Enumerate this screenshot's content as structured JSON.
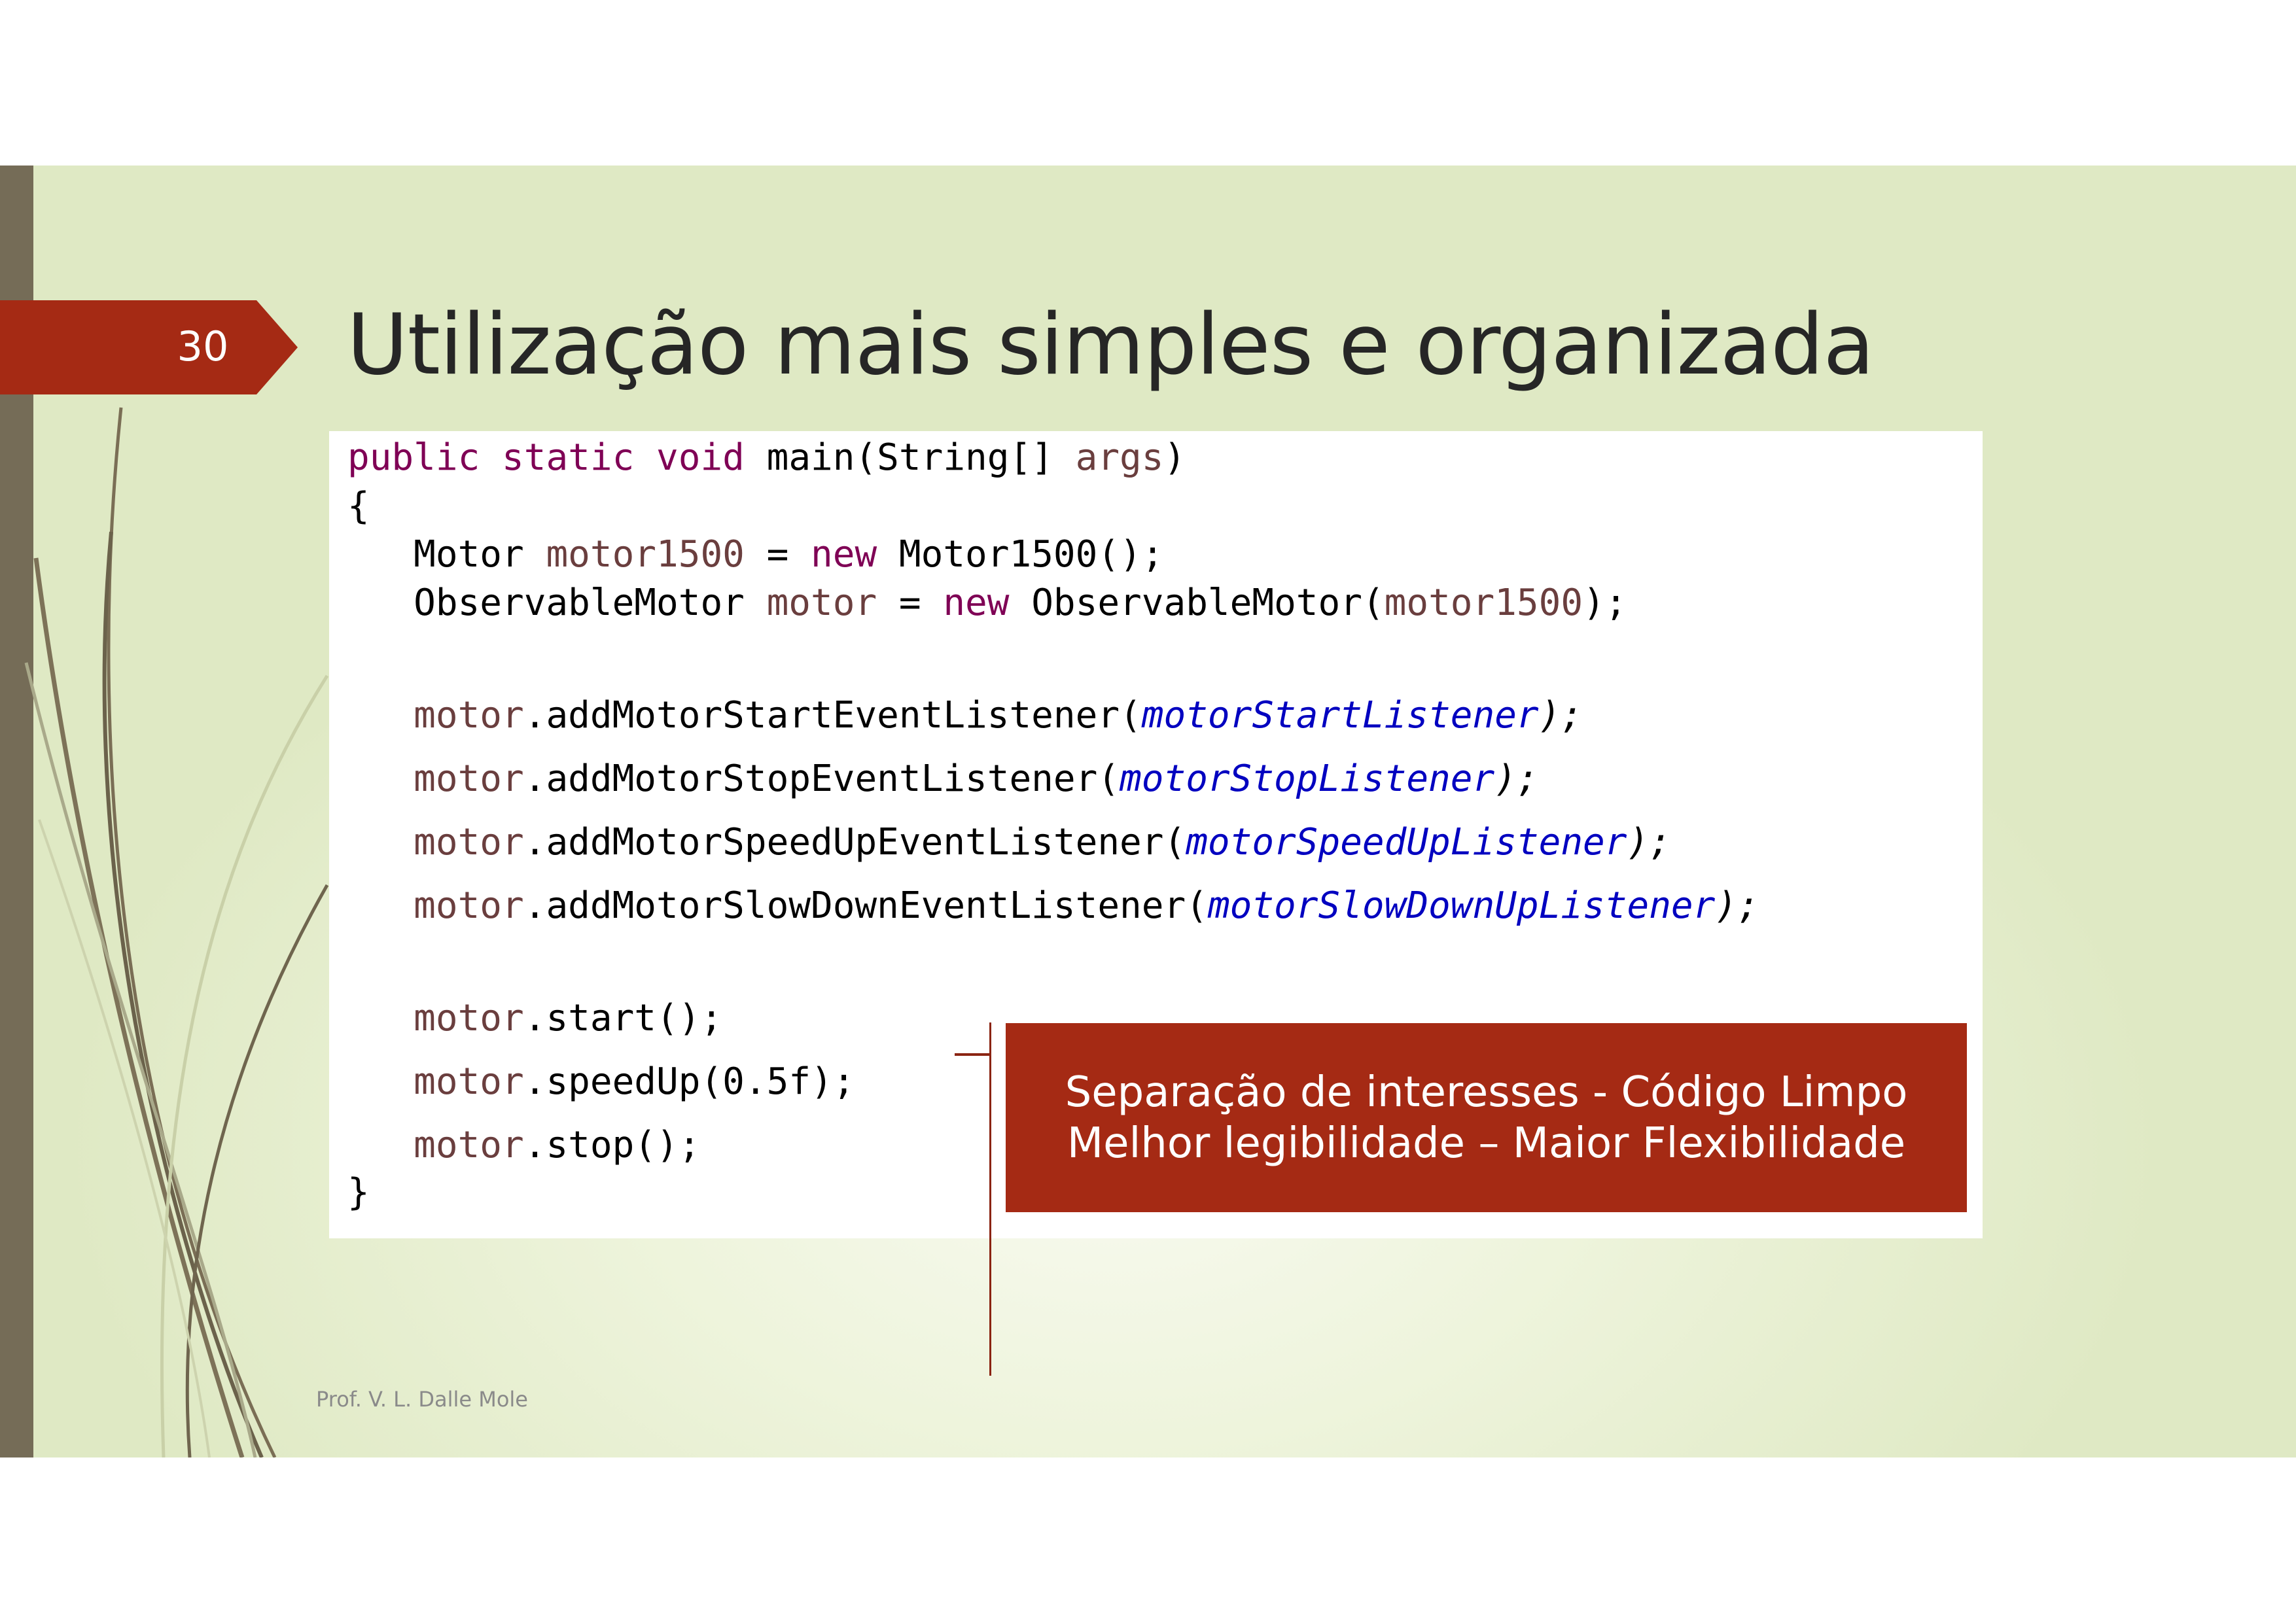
{
  "slide": {
    "number": "30",
    "title": "Utilização mais simples e organizada",
    "footer": "Prof. V. L. Dalle Mole"
  },
  "code": {
    "line1": {
      "kw1": "public",
      "kw2": "static",
      "kw3": "void",
      "rest": " main(String[] ",
      "var": "args",
      "end": ")"
    },
    "line2": "{",
    "line3": {
      "type": "   Motor ",
      "var": "motor1500",
      "eq": " = ",
      "kw": "new",
      "rest": " Motor1500();"
    },
    "line4": {
      "type": "   ObservableMotor ",
      "var": "motor",
      "eq": " = ",
      "kw": "new",
      "rest": " ObservableMotor(",
      "arg": "motor1500",
      "end": ");"
    },
    "listeners": [
      {
        "obj": "motor",
        "call": ".addMotorStartEventListener(",
        "arg": "motorStartListener",
        "end": ");"
      },
      {
        "obj": "motor",
        "call": ".addMotorStopEventListener(",
        "arg": "motorStopListener",
        "end": ");"
      },
      {
        "obj": "motor",
        "call": ".addMotorSpeedUpEventListener(",
        "arg": "motorSpeedUpListener",
        "end": ");"
      },
      {
        "obj": "motor",
        "call": ".addMotorSlowDownEventListener(",
        "arg": "motorSlowDownUpListener",
        "end": ");"
      }
    ],
    "calls": [
      {
        "obj": "motor",
        "call": ".start();"
      },
      {
        "obj": "motor",
        "call": ".speedUp(0.5f);"
      },
      {
        "obj": "motor",
        "call": ".stop();"
      }
    ],
    "closing": "}"
  },
  "callout": {
    "line1": "Separação de interesses - Código Limpo",
    "line2": "Melhor legibilidade – Maior Flexibilidade"
  },
  "colors": {
    "accent": "#a52a14",
    "bar": "#756c57",
    "keyword": "#7f0055",
    "variable": "#6a3e3e",
    "field": "#0000c0"
  }
}
